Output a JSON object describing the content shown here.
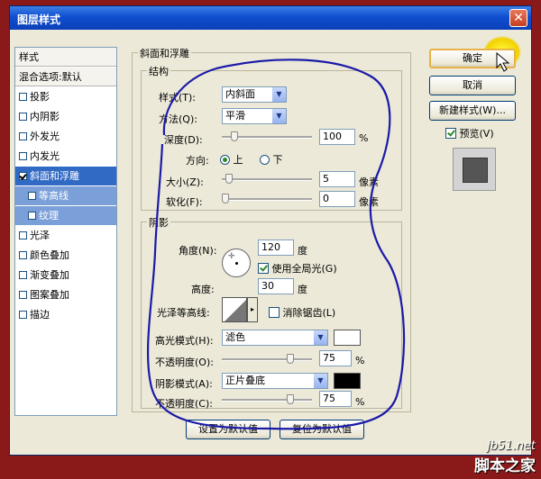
{
  "window": {
    "title": "图层样式",
    "close_glyph": "✕"
  },
  "styles_list": {
    "header": "样式",
    "blend": "混合选项:默认",
    "items": [
      {
        "label": "投影",
        "checked": false
      },
      {
        "label": "内阴影",
        "checked": false
      },
      {
        "label": "外发光",
        "checked": false
      },
      {
        "label": "内发光",
        "checked": false
      },
      {
        "label": "斜面和浮雕",
        "checked": true,
        "selected": true
      },
      {
        "label": "等高线",
        "checked": false,
        "sub": true
      },
      {
        "label": "纹理",
        "checked": false,
        "sub": true
      },
      {
        "label": "光泽",
        "checked": false
      },
      {
        "label": "颜色叠加",
        "checked": false
      },
      {
        "label": "渐变叠加",
        "checked": false
      },
      {
        "label": "图案叠加",
        "checked": false
      },
      {
        "label": "描边",
        "checked": false
      }
    ]
  },
  "bevel": {
    "group_title": "斜面和浮雕",
    "structure_title": "结构",
    "style_label": "样式(T):",
    "style_value": "内斜面",
    "method_label": "方法(Q):",
    "method_value": "平滑",
    "depth_label": "深度(D):",
    "depth_value": "100",
    "depth_unit": "%",
    "direction_label": "方向:",
    "dir_up": "上",
    "dir_down": "下",
    "size_label": "大小(Z):",
    "size_value": "5",
    "size_unit": "像素",
    "soften_label": "软化(F):",
    "soften_value": "0",
    "soften_unit": "像素"
  },
  "shading": {
    "title": "阴影",
    "angle_label": "角度(N):",
    "angle_value": "120",
    "angle_unit": "度",
    "global_light_label": "使用全局光(G)",
    "altitude_label": "高度:",
    "altitude_value": "30",
    "altitude_unit": "度",
    "gloss_label": "光泽等高线:",
    "antialias_label": "消除锯齿(L)",
    "highlight_mode_label": "高光模式(H):",
    "highlight_mode_value": "滤色",
    "highlight_color": "#ffffff",
    "hl_opacity_label": "不透明度(O):",
    "hl_opacity_value": "75",
    "shadow_mode_label": "阴影模式(A):",
    "shadow_mode_value": "正片叠底",
    "shadow_color": "#000000",
    "sh_opacity_label": "不透明度(C):",
    "sh_opacity_value": "75",
    "percent": "%"
  },
  "buttons": {
    "ok": "确定",
    "cancel": "取消",
    "new_style": "新建样式(W)...",
    "preview": "预览(V)",
    "make_default": "设置为默认值",
    "reset_default": "复位为默认值"
  },
  "watermark": {
    "url": "jb51.net",
    "name": "脚本之家"
  },
  "accent": {
    "title_blue": "#0f4fd0",
    "selected": "#316ac5",
    "scribble": "#1a1aa8"
  }
}
